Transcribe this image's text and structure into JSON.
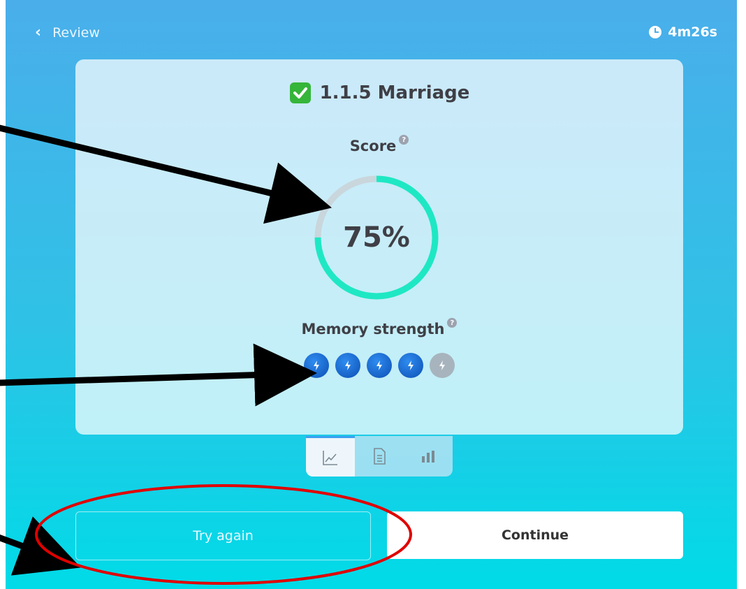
{
  "header": {
    "back_label": "Review",
    "timer": "4m26s"
  },
  "card": {
    "title": "1.1.5 Marriage",
    "score_label": "Score",
    "score_text": "75%",
    "score_value": 0.75,
    "memory_label": "Memory strength",
    "memory_level": 4,
    "memory_max": 5
  },
  "tabs": [
    {
      "name": "progress-chart",
      "icon": "line-chart-icon",
      "active": true
    },
    {
      "name": "document",
      "icon": "document-list-icon",
      "active": false
    },
    {
      "name": "stats",
      "icon": "bar-chart-icon",
      "active": false
    }
  ],
  "buttons": {
    "try_again": "Try again",
    "continue": "Continue"
  },
  "colors": {
    "ring": "#1ee8c4",
    "ring_track": "#c9d6dc",
    "annotation_arrow": "#000000",
    "annotation_ellipse": "#e00000"
  }
}
